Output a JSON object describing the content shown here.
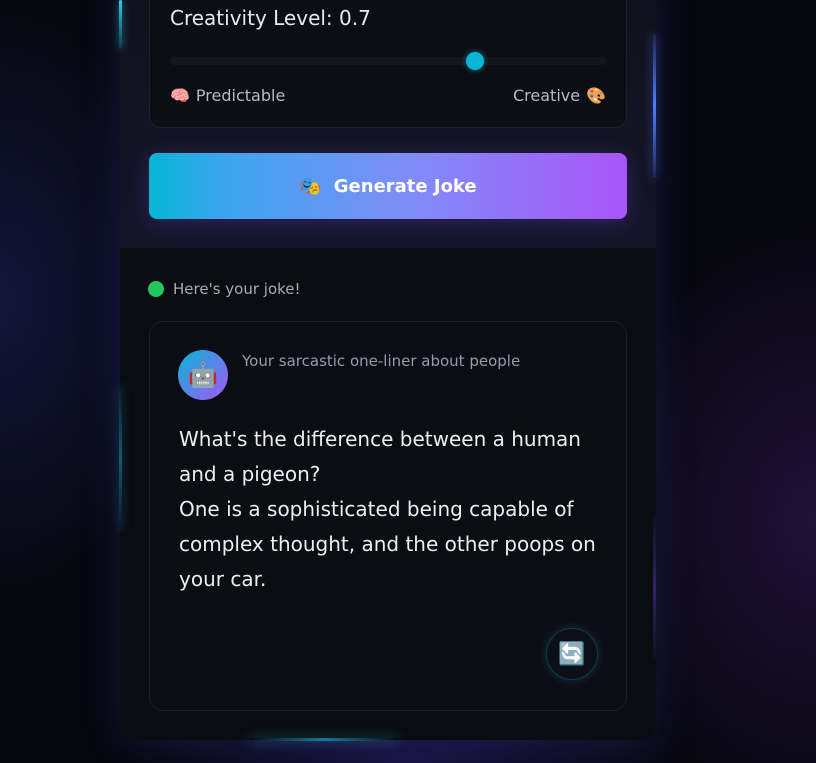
{
  "slider": {
    "title": "Creativity Level: 0.7",
    "value": 0.7,
    "min_label": "Predictable",
    "max_label": "Creative",
    "min_icon": "🧠",
    "max_icon": "🎨",
    "accent_color": "#06b6d4"
  },
  "generate_button": {
    "icon": "🎭",
    "label": "Generate Joke"
  },
  "status": {
    "text": "Here's your joke!",
    "color": "#22c55e"
  },
  "joke": {
    "avatar": "🤖",
    "subtitle": "Your sarcastic one-liner about people",
    "lines": [
      "What's the difference between a human and a pigeon?",
      "One is a sophisticated being capable of complex thought, and the other poops on your car."
    ],
    "refresh_icon": "🔄"
  }
}
